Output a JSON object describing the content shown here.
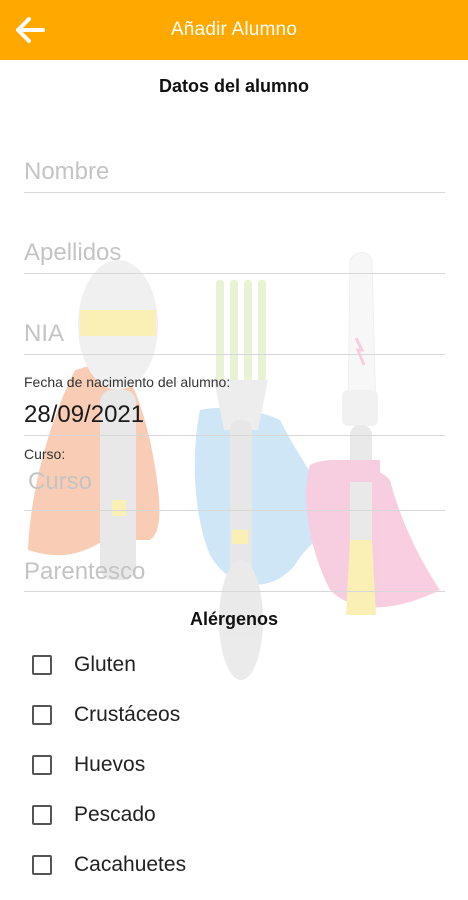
{
  "appbar": {
    "title": "Añadir Alumno",
    "back_icon": "arrow-left-icon",
    "color": "#FFA800"
  },
  "form": {
    "section_title": "Datos del alumno",
    "nombre_placeholder": "Nombre",
    "apellidos_placeholder": "Apellidos",
    "nia_placeholder": "NIA",
    "fecha_label": "Fecha de nacimiento del alumno:",
    "fecha_value": "28/09/2021",
    "curso_label": "Curso:",
    "curso_placeholder": "Curso",
    "parentesco_placeholder": "Parentesco"
  },
  "alergenos": {
    "title": "Alérgenos",
    "items": [
      {
        "label": "Gluten",
        "checked": false
      },
      {
        "label": "Crustáceos",
        "checked": false
      },
      {
        "label": "Huevos",
        "checked": false
      },
      {
        "label": "Pescado",
        "checked": false
      },
      {
        "label": "Cacahuetes",
        "checked": false
      }
    ]
  }
}
